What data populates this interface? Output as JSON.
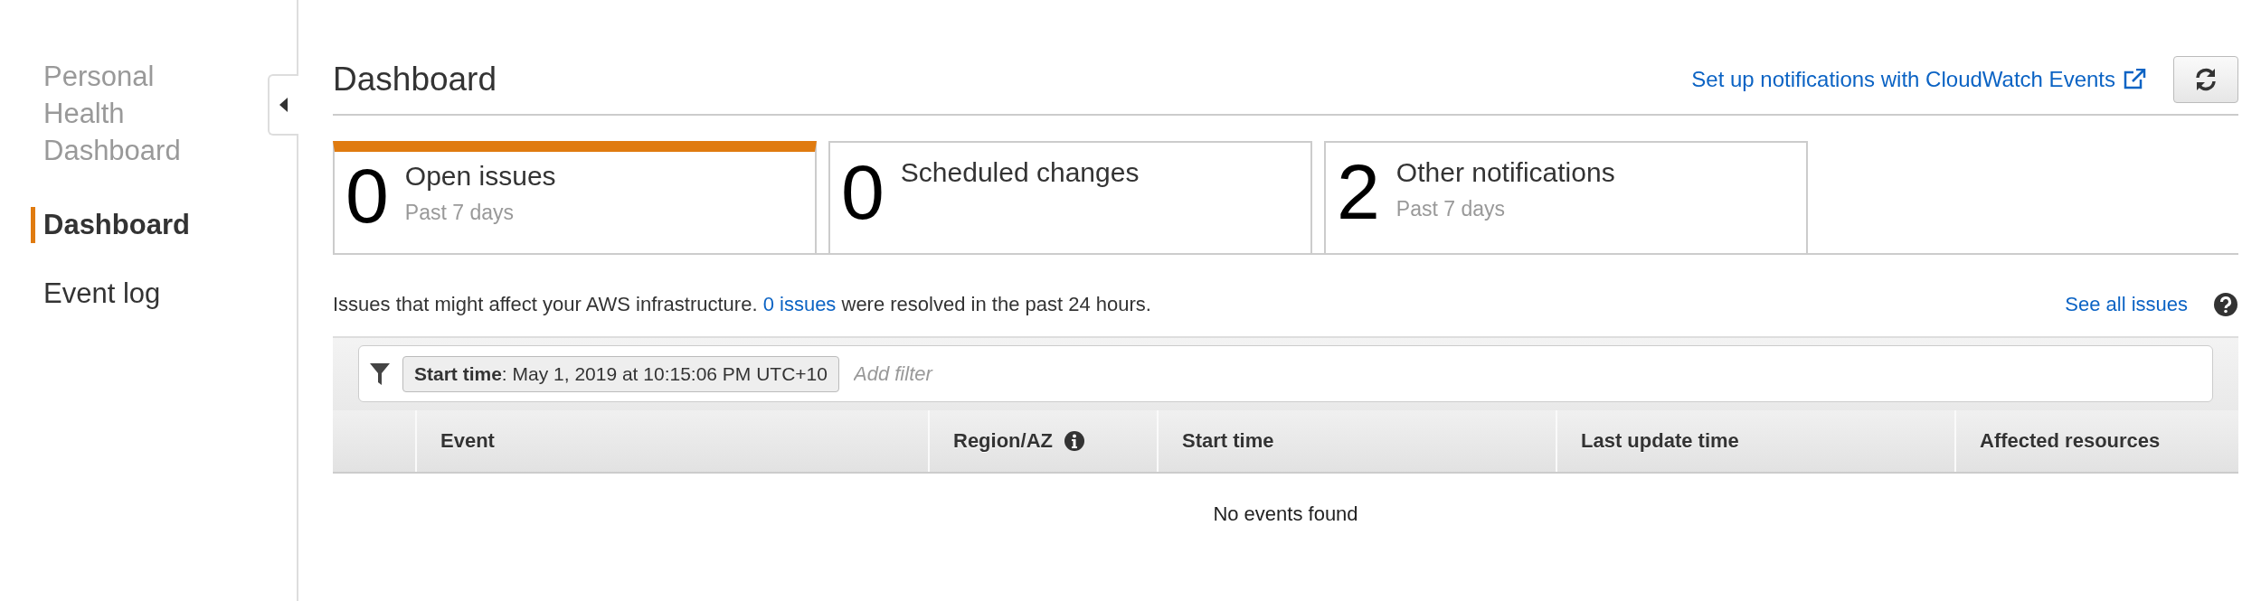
{
  "sidebar": {
    "title": "Personal Health Dashboard",
    "items": [
      {
        "label": "Dashboard",
        "selected": true
      },
      {
        "label": "Event log",
        "selected": false
      }
    ]
  },
  "header": {
    "title": "Dashboard",
    "link": "Set up notifications with CloudWatch Events"
  },
  "summary_tabs": [
    {
      "count": "0",
      "label": "Open issues",
      "subtitle": "Past 7 days",
      "selected": true
    },
    {
      "count": "0",
      "label": "Scheduled changes",
      "selected": false
    },
    {
      "count": "2",
      "label": "Other notifications",
      "subtitle": "Past 7 days",
      "selected": false
    }
  ],
  "info": {
    "text_before": "Issues that might affect your AWS infrastructure.",
    "link": "0 issues",
    "text_after": "were resolved in the past 24 hours.",
    "see_all": "See all issues"
  },
  "filter": {
    "token": "**Start time**: May 1, 2019 at 10:15:06 PM UTC+10",
    "placeholder": "Add filter"
  },
  "table": {
    "columns": [
      {
        "label": "Event"
      },
      {
        "label": "Region/AZ",
        "info": true
      },
      {
        "label": "Start time"
      },
      {
        "label": "Last update time"
      },
      {
        "label": "Affected resources"
      }
    ],
    "empty_message": "No events found"
  }
}
